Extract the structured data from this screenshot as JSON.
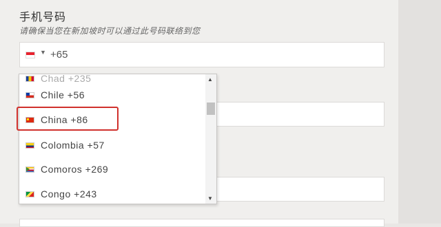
{
  "form": {
    "field_title": "手机号码",
    "field_hint": "请确保当您在新加坡时可以通过此号码联络到您",
    "phone": {
      "selected_flag_icon": "singapore-flag-icon",
      "dial_code": "+65"
    }
  },
  "dropdown": {
    "partial_item": {
      "label": "Chad +235",
      "flag_icon": "chad-flag-icon"
    },
    "items": [
      {
        "label": "Chile +56",
        "flag_icon": "chile-flag-icon"
      },
      {
        "label": "China +86",
        "flag_icon": "china-flag-icon"
      },
      {
        "label": "Colombia +57",
        "flag_icon": "colombia-flag-icon"
      },
      {
        "label": "Comoros +269",
        "flag_icon": "comoros-flag-icon"
      },
      {
        "label": "Congo +243",
        "flag_icon": "congo-flag-icon"
      }
    ],
    "highlighted_item": "China +86",
    "scroll_position": 0.2
  },
  "colors": {
    "highlight": "#d0302c",
    "page_bg": "#f0efed",
    "input_bg": "#ffffff"
  }
}
